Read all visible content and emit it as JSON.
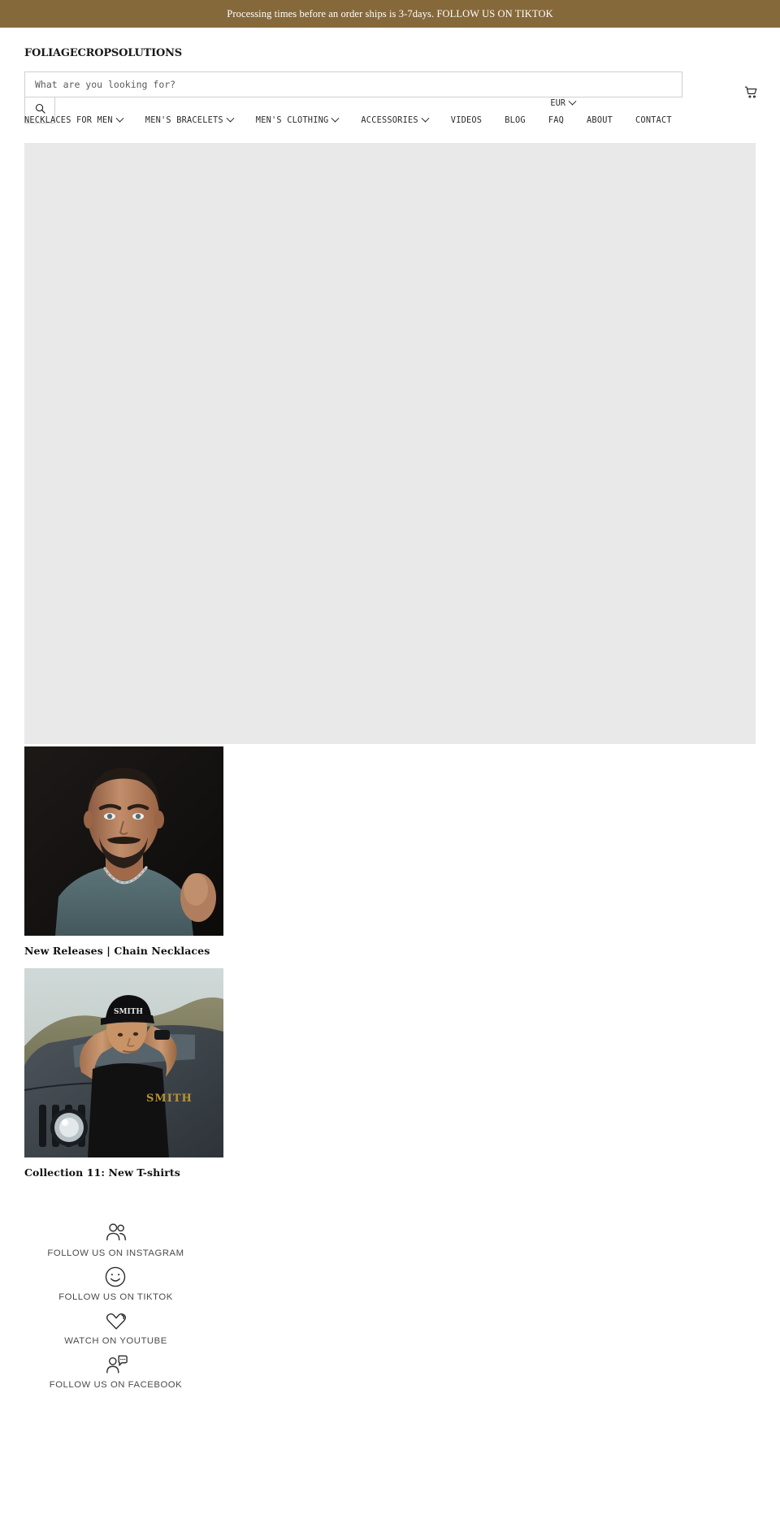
{
  "announcement": {
    "text": "Processing times before an order ships is 3-7days. FOLLOW US ON TIKTOK"
  },
  "header": {
    "logo": "FOLIAGECROPSOLUTIONS",
    "cart_icon": "shopping-cart-icon",
    "currency": {
      "value": "EUR",
      "chevron_icon": "chevron-down-icon"
    }
  },
  "search": {
    "placeholder": "What are you looking for?",
    "value": "",
    "submit_icon": "search-icon"
  },
  "nav": {
    "items": [
      {
        "label": "NECKLACES FOR MEN",
        "has_dropdown": true
      },
      {
        "label": "MEN'S BRACELETS",
        "has_dropdown": true
      },
      {
        "label": "MEN'S CLOTHING",
        "has_dropdown": true
      },
      {
        "label": "ACCESSORIES",
        "has_dropdown": true
      },
      {
        "label": "VIDEOS",
        "has_dropdown": false
      },
      {
        "label": "BLOG",
        "has_dropdown": false
      },
      {
        "label": "FAQ",
        "has_dropdown": false
      },
      {
        "label": "ABOUT",
        "has_dropdown": false
      },
      {
        "label": "CONTACT",
        "has_dropdown": false
      }
    ]
  },
  "hero": {
    "placeholder_color": "#e9e9e9"
  },
  "collections": [
    {
      "title": "New Releases | Chain Necklaces"
    },
    {
      "title": "Collection 11: New T-shirts"
    }
  ],
  "social": {
    "items": [
      {
        "label": "FOLLOW US ON INSTAGRAM",
        "icon": "two-people-icon"
      },
      {
        "label": "FOLLOW US ON TIKTOK",
        "icon": "smiley-face-icon"
      },
      {
        "label": "WATCH ON YOUTUBE",
        "icon": "heart-icon"
      },
      {
        "label": "FOLLOW US ON FACEBOOK",
        "icon": "person-chat-icon"
      }
    ]
  },
  "colors": {
    "announcement_bg": "#86693a",
    "text_primary": "#1a1a1a",
    "text_muted": "#4a4a4a",
    "placeholder_gray": "#e9e9e9"
  }
}
